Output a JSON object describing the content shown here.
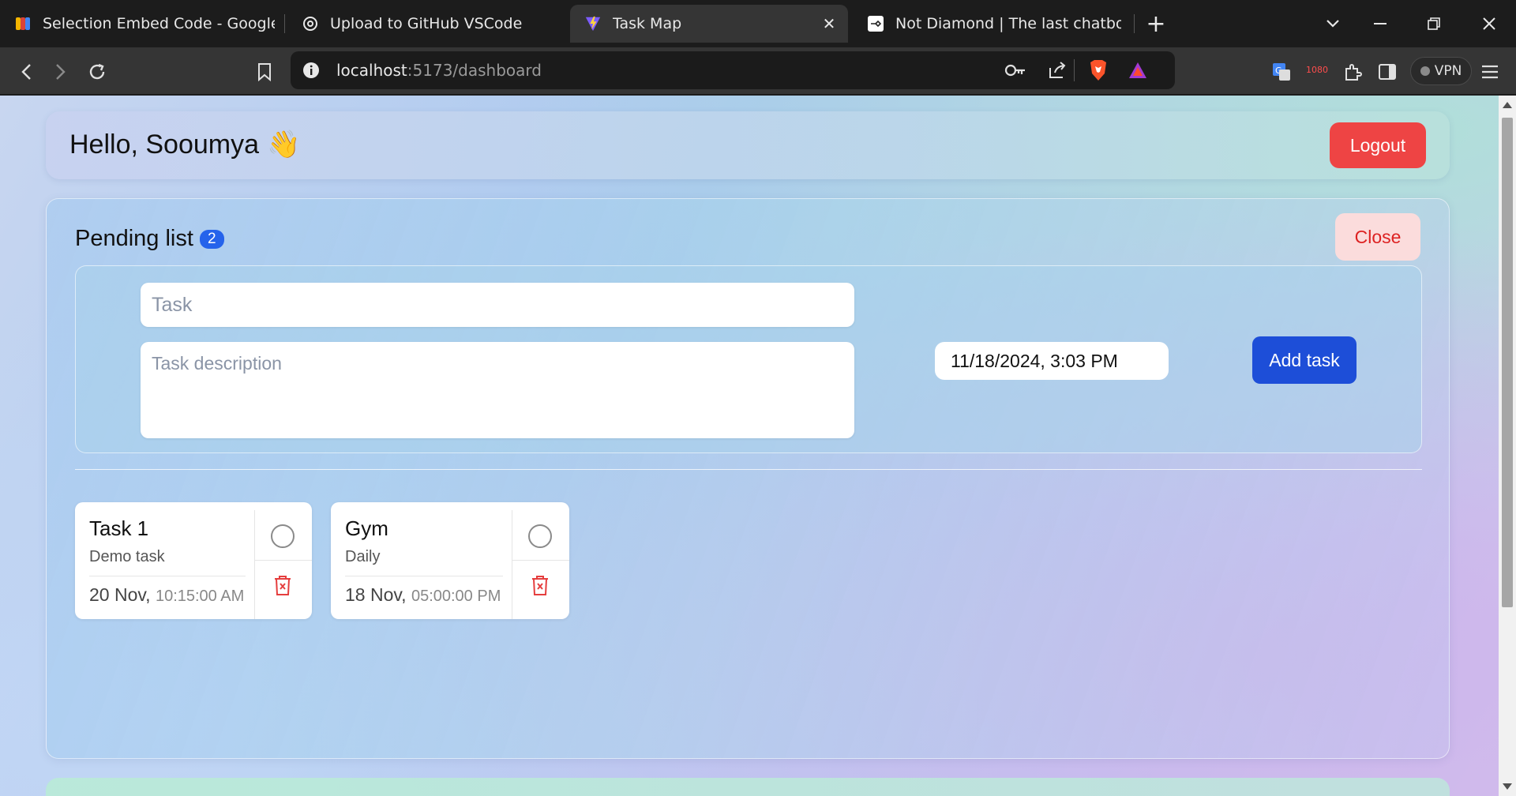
{
  "browser": {
    "tabs": [
      {
        "title": "Selection Embed Code - Google For",
        "icon": "google-forms-icon"
      },
      {
        "title": "Upload to GitHub VSCode",
        "icon": "chatgpt-icon"
      },
      {
        "title": "Task Map",
        "icon": "vite-icon",
        "active": true
      },
      {
        "title": "Not Diamond | The last chatbot you",
        "icon": "notdiamond-icon"
      }
    ],
    "url_host": "localhost",
    "url_path": ":5173/dashboard",
    "extension_badge": "1080",
    "vpn_label": "VPN"
  },
  "header": {
    "greeting": "Hello, Sooumya",
    "wave": "👋",
    "logout_label": "Logout"
  },
  "pending": {
    "title": "Pending list",
    "count": "2",
    "close_label": "Close",
    "form": {
      "task_placeholder": "Task",
      "description_placeholder": "Task description",
      "datetime_value": "11/18/2024, 3:03 PM",
      "add_label": "Add task"
    },
    "tasks": [
      {
        "title": "Task 1",
        "description": "Demo task",
        "date": "20 Nov,",
        "time": "10:15:00 AM"
      },
      {
        "title": "Gym",
        "description": "Daily",
        "date": "18 Nov,",
        "time": "05:00:00 PM"
      }
    ]
  },
  "colors": {
    "logout": "#ee4444",
    "add_task": "#1d4ed8",
    "badge": "#2563eb",
    "close_bg": "#fbdcdc",
    "close_text": "#dd2222",
    "trash": "#e53e3e"
  }
}
